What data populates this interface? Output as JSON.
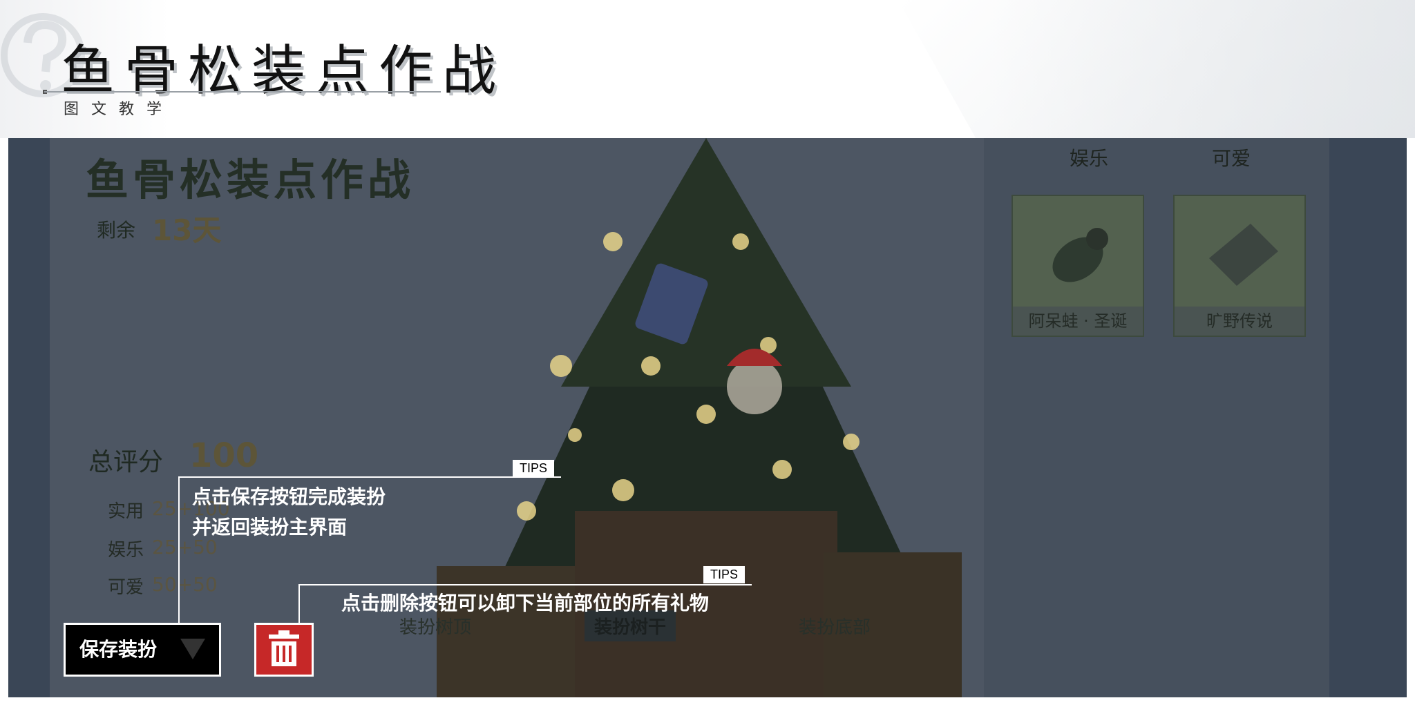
{
  "header": {
    "title": "鱼骨松装点作战",
    "subtitle": "图文教学"
  },
  "game": {
    "title": "鱼骨松装点作战",
    "remain_label": "剩余",
    "remain_value": "13天",
    "score_label": "总评分",
    "score_value": "100",
    "stats": [
      {
        "label": "实用",
        "value": "25+100"
      },
      {
        "label": "娱乐",
        "value": "25+50"
      },
      {
        "label": "可爱",
        "value": "50+50"
      }
    ],
    "categories": [
      "娱乐",
      "可爱"
    ],
    "items": [
      {
        "label": "阿呆蛙 · 圣诞",
        "icon": "frog-plush-icon"
      },
      {
        "label": "旷野传说",
        "icon": "game-box-icon"
      }
    ],
    "parts": [
      {
        "label": "装扮树顶",
        "active": false
      },
      {
        "label": "装扮树干",
        "active": true
      },
      {
        "label": "装扮底部",
        "active": false
      }
    ],
    "save_label": "保存装扮"
  },
  "tips": [
    {
      "badge": "TIPS",
      "lines": [
        "点击保存按钮完成装扮",
        "并返回装扮主界面"
      ]
    },
    {
      "badge": "TIPS",
      "lines": [
        "点击删除按钮可以卸下当前部位的所有礼物"
      ]
    }
  ],
  "colors": {
    "overlay": "#3a4656",
    "delete_button": "#c62828",
    "save_button": "#000000"
  }
}
